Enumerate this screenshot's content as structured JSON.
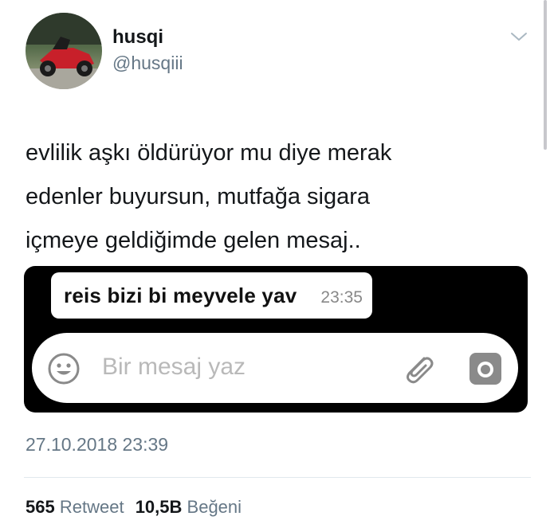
{
  "user": {
    "display_name": "husqi",
    "handle": "@husqiii"
  },
  "tweet": {
    "lines": [
      "evlilik aşkı öldürüyor mu diye merak",
      "edenler buyursun, mutfağa sigara",
      "içmeye geldiğimde gelen mesaj.."
    ],
    "timestamp": "27.10.2018 23:39"
  },
  "media": {
    "message_text": "reis bizi bi meyvele yav",
    "message_time": "23:35",
    "input_placeholder": "Bir mesaj yaz",
    "icons": [
      "emoji-icon",
      "attachment-icon",
      "camera-icon"
    ]
  },
  "stats": {
    "retweets_count": "565",
    "retweets_label": "Retweet",
    "likes_count": "10,5B",
    "likes_label": "Beğeni"
  },
  "colors": {
    "secondary_text": "#657786",
    "primary_text": "#14171a",
    "media_background": "#000000"
  }
}
